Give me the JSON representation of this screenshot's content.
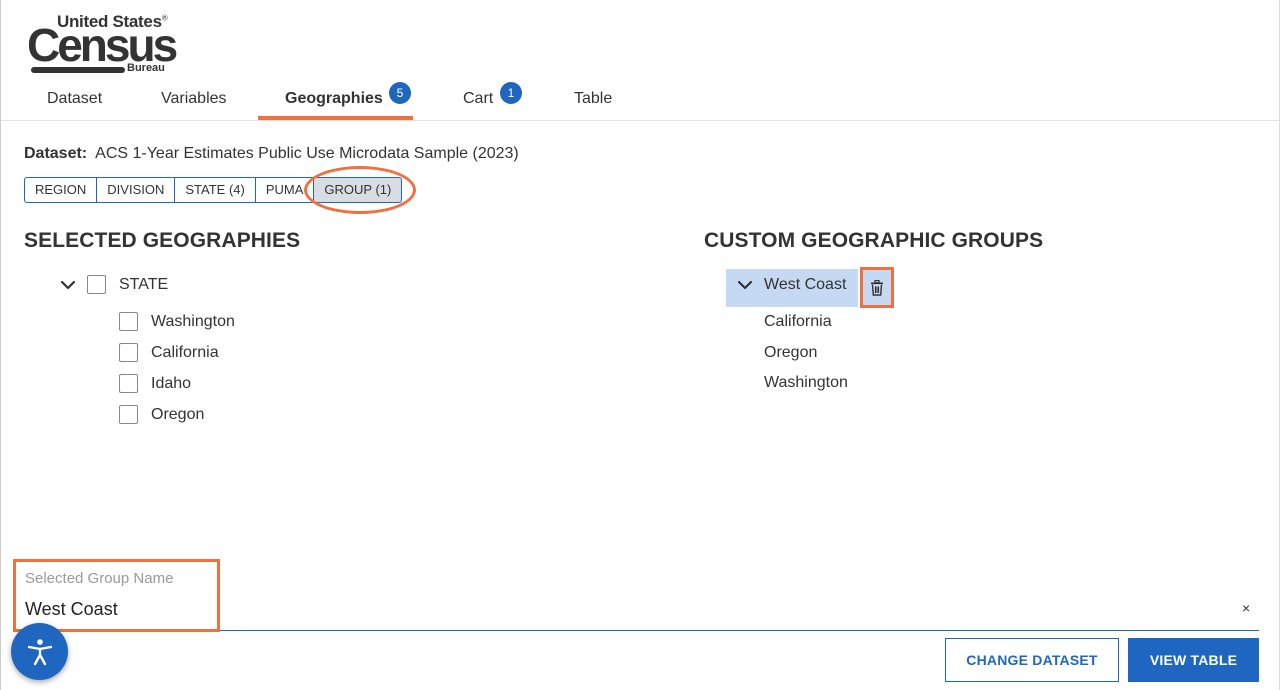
{
  "logo": {
    "line1": "United States",
    "registered": "®",
    "line2": "Census",
    "line3": "Bureau"
  },
  "tabs": [
    {
      "label": "Dataset"
    },
    {
      "label": "Variables"
    },
    {
      "label": "Geographies",
      "badge": "5",
      "active": true
    },
    {
      "label": "Cart",
      "badge": "1"
    },
    {
      "label": "Table"
    }
  ],
  "dataset": {
    "label": "Dataset:",
    "value": "ACS 1-Year Estimates Public Use Microdata Sample (2023)"
  },
  "chips": [
    {
      "label": "REGION"
    },
    {
      "label": "DIVISION"
    },
    {
      "label": "STATE (4)"
    },
    {
      "label": "PUMA"
    },
    {
      "label": "GROUP (1)",
      "selected": true
    }
  ],
  "selected_geographies": {
    "heading": "SELECTED GEOGRAPHIES",
    "parent": "STATE",
    "items": [
      "Washington",
      "California",
      "Idaho",
      "Oregon"
    ]
  },
  "custom_groups": {
    "heading": "CUSTOM GEOGRAPHIC GROUPS",
    "group_name": "West Coast",
    "members": [
      "California",
      "Oregon",
      "Washington"
    ]
  },
  "group_name_field": {
    "label": "Selected Group Name",
    "value": "West Coast",
    "clear": "×"
  },
  "buttons": {
    "change_dataset": "CHANGE DATASET",
    "view_table": "VIEW TABLE"
  },
  "colors": {
    "accent_blue": "#1f66c1",
    "highlight_orange": "#f07040",
    "group_row_bg": "#c6d9f2"
  },
  "icons": [
    "chevron-down-icon",
    "trash-icon",
    "accessibility-icon",
    "close-icon"
  ]
}
